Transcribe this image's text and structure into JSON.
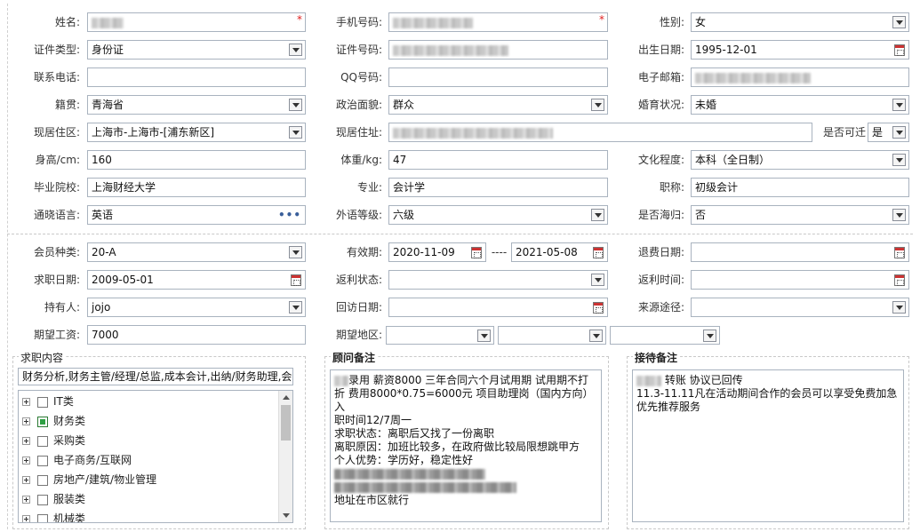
{
  "personal": {
    "name_label": "姓名:",
    "phone_label": "手机号码:",
    "gender_label": "性别:",
    "gender_value": "女",
    "idtype_label": "证件类型:",
    "idtype_value": "身份证",
    "idno_label": "证件号码:",
    "birth_label": "出生日期:",
    "birth_value": "1995-12-01",
    "tel_label": "联系电话:",
    "qq_label": "QQ号码:",
    "email_label": "电子邮箱:",
    "native_label": "籍贯:",
    "native_value": "青海省",
    "political_label": "政治面貌:",
    "political_value": "群众",
    "marital_label": "婚育状况:",
    "marital_value": "未婚",
    "area_label": "现居住区:",
    "area_value": "上海市-上海市-[浦东新区]",
    "address_label": "现居住址:",
    "relocate_label": "是否可迁",
    "relocate_value": "是",
    "height_label": "身高/cm:",
    "height_value": "160",
    "weight_label": "体重/kg:",
    "weight_value": "47",
    "edu_label": "文化程度:",
    "edu_value": "本科（全日制）",
    "school_label": "毕业院校:",
    "school_value": "上海财经大学",
    "major_label": "专业:",
    "major_value": "会计学",
    "title_label": "职称:",
    "title_value": "初级会计",
    "lang_label": "通晓语言:",
    "lang_value": "英语",
    "langlevel_label": "外语等级:",
    "langlevel_value": "六级",
    "overseas_label": "是否海归:",
    "overseas_value": "否"
  },
  "member": {
    "type_label": "会员种类:",
    "type_value": "20-A",
    "valid_label": "有效期:",
    "valid_from": "2020-11-09",
    "valid_sep": "----",
    "valid_to": "2021-05-08",
    "refund_label": "退费日期:",
    "jobdate_label": "求职日期:",
    "jobdate_value": "2009-05-01",
    "rebate_status_label": "返利状态:",
    "rebate_time_label": "返利时间:",
    "holder_label": "持有人:",
    "holder_value": "jojo",
    "visit_label": "回访日期:",
    "source_label": "来源途径:",
    "salary_label": "期望工资:",
    "salary_value": "7000",
    "region_label": "期望地区:"
  },
  "job_content": {
    "title": "求职内容",
    "summary": "财务分析,财务主管/经理/总监,成本会计,出纳/财务助理,会计",
    "categories": [
      {
        "label": "IT类",
        "checked": false
      },
      {
        "label": "财务类",
        "checked": true
      },
      {
        "label": "采购类",
        "checked": false
      },
      {
        "label": "电子商务/互联网",
        "checked": false
      },
      {
        "label": "房地产/建筑/物业管理",
        "checked": false
      },
      {
        "label": "服装类",
        "checked": false
      },
      {
        "label": "机械类",
        "checked": false
      }
    ]
  },
  "advisor_notes": {
    "title": "顾问备注",
    "lines": [
      "录用 薪资8000 三年合同六个月试用期 试用期不打",
      "折 费用8000*0.75=6000元 项目助理岗（国内方向）入",
      "职时间12/7周一",
      "",
      "求职状态：离职后又找了一份离职",
      "离职原因：加班比较多，在政府做比较局限想跳甲方",
      "个人优势：学历好，稳定性好",
      "",
      "",
      "地址在市区就行"
    ]
  },
  "reception_notes": {
    "title": "接待备注",
    "lines": [
      "转账 协议已回传",
      "11.3-11.11凡在活动期间合作的会员可以享受免费加急",
      "优先推荐服务"
    ]
  }
}
